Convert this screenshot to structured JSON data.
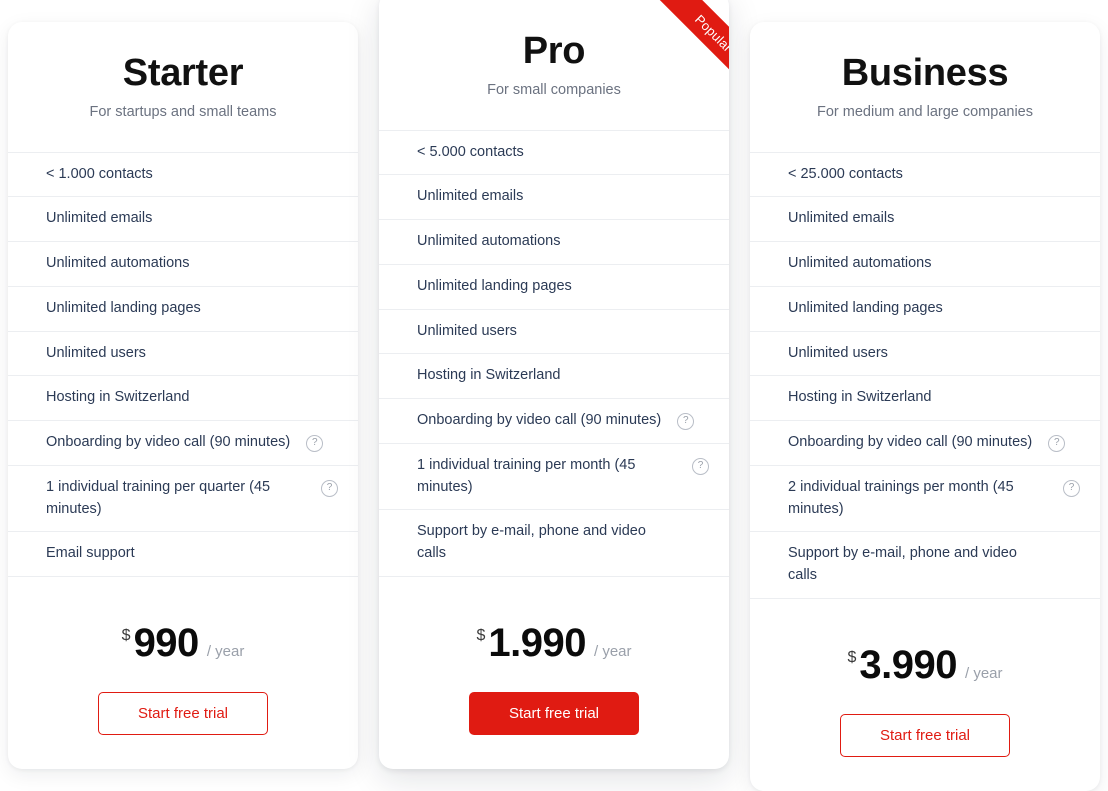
{
  "theme": {
    "accent": "#e01b12",
    "text_dark": "#2b3a55",
    "heading": "#111111",
    "muted": "#6b7280",
    "page_background": "#ffffff"
  },
  "plans": [
    {
      "id": "starter",
      "name": "Starter",
      "tagline": "For startups and small teams",
      "badge": null,
      "features": [
        {
          "text": "< 1.000 contacts",
          "help": false
        },
        {
          "text": "Unlimited emails",
          "help": false
        },
        {
          "text": "Unlimited automations",
          "help": false
        },
        {
          "text": "Unlimited landing pages",
          "help": false
        },
        {
          "text": "Unlimited users",
          "help": false
        },
        {
          "text": "Hosting in Switzerland",
          "help": false
        },
        {
          "text": "Onboarding by video call (90 minutes)",
          "help": true,
          "help_inline": true
        },
        {
          "text": "1 individual training per quarter (45 minutes)",
          "help": true,
          "help_inline": false
        },
        {
          "text": "Email support",
          "help": false
        }
      ],
      "price": {
        "currency": "$",
        "amount": "990",
        "period": "/ year"
      },
      "cta": {
        "label": "Start free trial",
        "style": "outline"
      }
    },
    {
      "id": "pro",
      "name": "Pro",
      "tagline": "For small companies",
      "badge": "Popular",
      "features": [
        {
          "text": "< 5.000 contacts",
          "help": false
        },
        {
          "text": "Unlimited emails",
          "help": false
        },
        {
          "text": "Unlimited automations",
          "help": false
        },
        {
          "text": "Unlimited landing pages",
          "help": false
        },
        {
          "text": "Unlimited users",
          "help": false
        },
        {
          "text": "Hosting in Switzerland",
          "help": false
        },
        {
          "text": "Onboarding by video call (90 minutes)",
          "help": true,
          "help_inline": true
        },
        {
          "text": "1 individual training per month (45 minutes)",
          "help": true,
          "help_inline": false
        },
        {
          "text": "Support by e-mail, phone and video calls",
          "help": false
        }
      ],
      "price": {
        "currency": "$",
        "amount": "1.990",
        "period": "/ year"
      },
      "cta": {
        "label": "Start free trial",
        "style": "solid"
      }
    },
    {
      "id": "business",
      "name": "Business",
      "tagline": "For medium and large companies",
      "badge": null,
      "features": [
        {
          "text": "< 25.000 contacts",
          "help": false
        },
        {
          "text": "Unlimited emails",
          "help": false
        },
        {
          "text": "Unlimited automations",
          "help": false
        },
        {
          "text": "Unlimited landing pages",
          "help": false
        },
        {
          "text": "Unlimited users",
          "help": false
        },
        {
          "text": "Hosting in Switzerland",
          "help": false
        },
        {
          "text": "Onboarding by video call (90 minutes)",
          "help": true,
          "help_inline": true
        },
        {
          "text": "2 individual trainings per month (45 minutes)",
          "help": true,
          "help_inline": false
        },
        {
          "text": "Support by e-mail, phone and video calls",
          "help": false
        }
      ],
      "price": {
        "currency": "$",
        "amount": "3.990",
        "period": "/ year"
      },
      "cta": {
        "label": "Start free trial",
        "style": "outline"
      }
    }
  ],
  "icons": {
    "help": "?",
    "help_icon_name": "help-circle-icon"
  }
}
